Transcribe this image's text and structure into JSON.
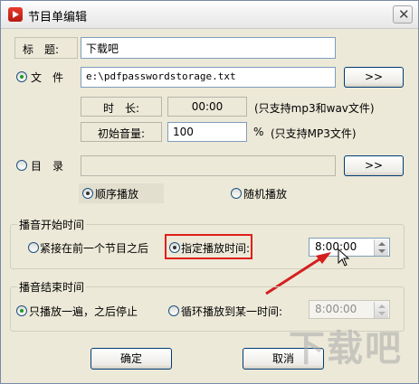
{
  "window": {
    "title": "节目单编辑",
    "close_symbol": "✕"
  },
  "title_row": {
    "label": "标　题:",
    "value": "下载吧"
  },
  "file_row": {
    "label": "文　件",
    "value": "e:\\pdfpasswordstorage.txt",
    "browse_label": ">>"
  },
  "duration_row": {
    "label": "时　长:",
    "value": "00:00",
    "note": "(只支持mp3和wav文件)"
  },
  "volume_row": {
    "label": "初始音量:",
    "value": "100",
    "unit": "%",
    "note": "(只支持MP3文件)"
  },
  "dir_row": {
    "label": "目　录",
    "value": "",
    "browse_label": ">>"
  },
  "play_mode": {
    "sequential": "顺序播放",
    "random": "随机播放"
  },
  "start_group": {
    "legend": "播音开始时间",
    "after_previous": "紧接在前一个节目之后",
    "specified": "指定播放时间:",
    "time": "8:00:00"
  },
  "end_group": {
    "legend": "播音结束时间",
    "play_once": "只播放一遍，之后停止",
    "loop_until": "循环播放到某一时间:",
    "time": "8:00:00"
  },
  "buttons": {
    "ok": "确定",
    "cancel": "取消"
  },
  "watermark": "下载吧",
  "colors": {
    "highlight_box": "#e0201a",
    "arrow": "#d41f1f",
    "input_border": "#7f9db9",
    "button_border": "#003c74"
  }
}
